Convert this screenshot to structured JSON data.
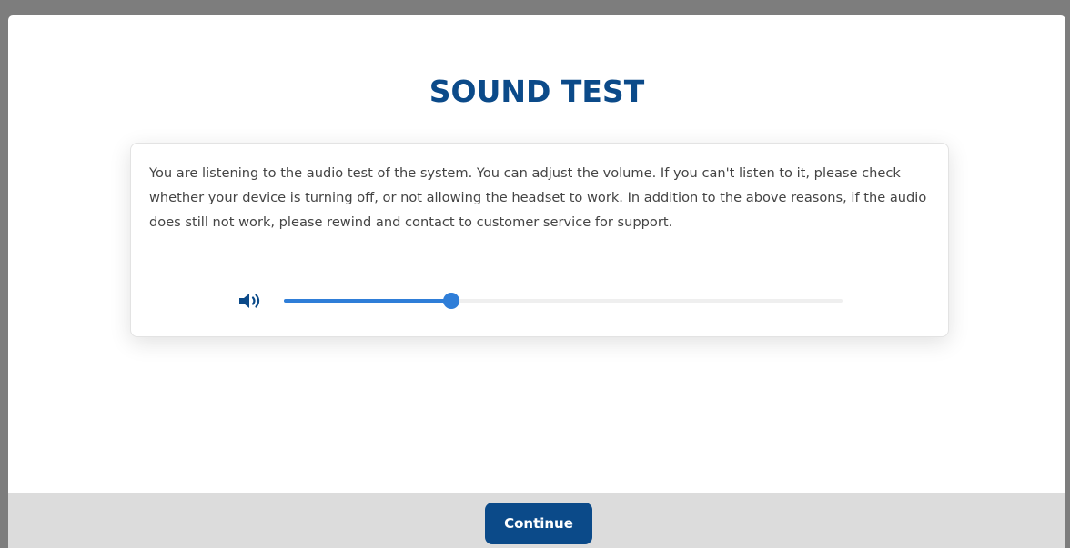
{
  "page": {
    "title": "SOUND TEST"
  },
  "card": {
    "text": "You are listening to the audio test of the system. You can adjust the volume. If you can't listen to it, please check whether your device is turning off, or not allowing the headset to work. In addition to the above reasons, if the audio does still not work, please rewind and contact to customer service for support."
  },
  "volume": {
    "icon": "speaker-volume-icon",
    "level": 0.3
  },
  "footer": {
    "continue_label": "Continue"
  },
  "colors": {
    "primary": "#0b4a89",
    "slider": "#2f7ed8",
    "footer_bg": "#dcdcdc"
  }
}
